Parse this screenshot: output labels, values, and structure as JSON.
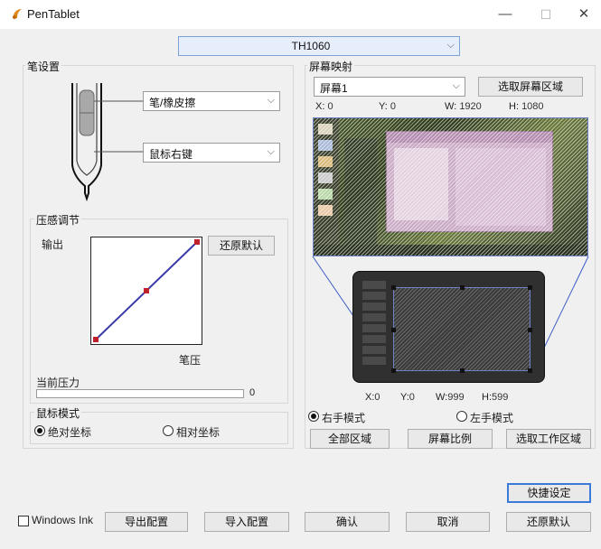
{
  "window": {
    "title": "PenTablet",
    "minimize_glyph": "—",
    "maximize_glyph": "☐",
    "close_glyph": "✕"
  },
  "device_select": {
    "value": "TH1060"
  },
  "pen_settings": {
    "group_label": "笔设置",
    "upper_button_select": "笔/橡皮擦",
    "lower_button_select": "鼠标右键"
  },
  "pressure": {
    "group_label": "压感调节",
    "y_label": "输出",
    "x_label": "笔压",
    "reset_button": "还原默认",
    "current_label": "当前压力",
    "current_value": "0",
    "current_fraction": 0,
    "curve_points": [
      [
        0,
        0
      ],
      [
        0.5,
        0.5
      ],
      [
        1,
        1
      ]
    ]
  },
  "mouse_mode": {
    "group_label": "鼠标模式",
    "absolute_label": "绝对坐标",
    "relative_label": "相对坐标",
    "selected": "absolute"
  },
  "screen_mapping": {
    "group_label": "屏幕映射",
    "screen_select": "屏幕1",
    "select_area_button": "选取屏幕区域",
    "screen_coords": {
      "x_label": "X:",
      "x": "0",
      "y_label": "Y:",
      "y": "0",
      "w_label": "W:",
      "w": "1920",
      "h_label": "H:",
      "h": "1080"
    },
    "tablet_coords": {
      "x_label": "X:",
      "x": "0",
      "y_label": "Y:",
      "y": "0",
      "w_label": "W:",
      "w": "999",
      "h_label": "H:",
      "h": "599"
    },
    "right_hand_label": "右手模式",
    "left_hand_label": "左手模式",
    "hand_selected": "right",
    "full_area_button": "全部区域",
    "screen_ratio_button": "屏幕比例",
    "select_work_area_button": "选取工作区域"
  },
  "shortcut_button": "快捷设定",
  "footer": {
    "windows_ink_label": "Windows Ink",
    "export_button": "导出配置",
    "import_button": "导入配置",
    "ok_button": "确认",
    "cancel_button": "取消",
    "reset_button": "还原默认"
  },
  "colors": {
    "curve_line": "#3a3aa8",
    "curve_point": "#c0202a",
    "mapping_line": "#3b5dc9",
    "accent": "#3b7ad9"
  }
}
